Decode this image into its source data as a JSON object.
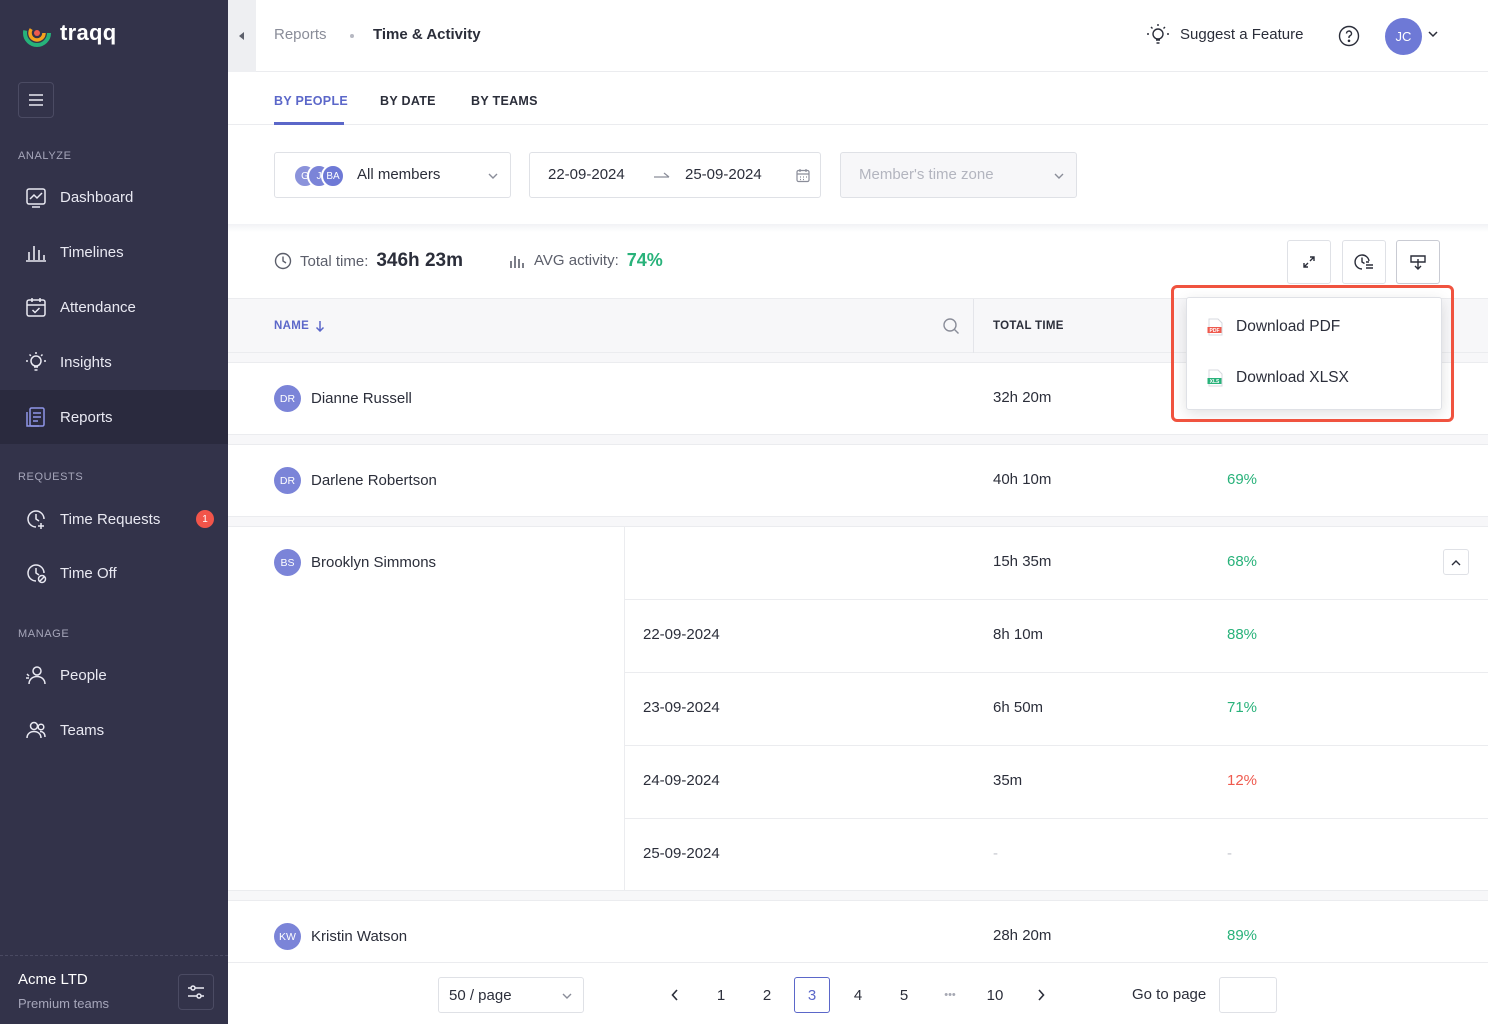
{
  "brand": {
    "name": "traqq"
  },
  "sidebar": {
    "sections": {
      "analyze": "ANALYZE",
      "requests": "REQUESTS",
      "manage": "MANAGE"
    },
    "items": {
      "dashboard": "Dashboard",
      "timelines": "Timelines",
      "attendance": "Attendance",
      "insights": "Insights",
      "reports": "Reports",
      "time_requests": "Time Requests",
      "time_requests_badge": "1",
      "time_off": "Time Off",
      "people": "People",
      "teams": "Teams"
    },
    "footer": {
      "org": "Acme LTD",
      "plan": "Premium teams"
    }
  },
  "header": {
    "breadcrumb_parent": "Reports",
    "breadcrumb_current": "Time & Activity",
    "suggest": "Suggest a Feature",
    "avatar": "JC"
  },
  "tabs": {
    "by_people": "BY PEOPLE",
    "by_date": "BY DATE",
    "by_teams": "BY TEAMS"
  },
  "filters": {
    "members_avatars": [
      "G",
      "J",
      "BA"
    ],
    "members_label": "All members",
    "date_from": "22-09-2024",
    "date_to": "25-09-2024",
    "timezone_placeholder": "Member's time zone"
  },
  "summary": {
    "total_label": "Total time:",
    "total_value": "346h 23m",
    "avg_label": "AVG activity:",
    "avg_value": "74%"
  },
  "table": {
    "col_name": "NAME",
    "col_total": "TOTAL TIME",
    "rows": [
      {
        "initials": "DR",
        "name": "Dianne Russell",
        "time": "32h 20m"
      },
      {
        "initials": "DR",
        "name": "Darlene Robertson",
        "time": "40h 10m",
        "activity": "69%"
      },
      {
        "initials": "BS",
        "name": "Brooklyn Simmons",
        "time": "15h 35m",
        "activity": "68%"
      },
      {
        "initials": "KW",
        "name": "Kristin Watson",
        "time": "28h 20m",
        "activity": "89%"
      }
    ],
    "subrows": [
      {
        "date": "22-09-2024",
        "time": "8h 10m",
        "activity": "88%"
      },
      {
        "date": "23-09-2024",
        "time": "6h 50m",
        "activity": "71%"
      },
      {
        "date": "24-09-2024",
        "time": "35m",
        "activity": "12%"
      },
      {
        "date": "25-09-2024",
        "time": "-",
        "activity": "-"
      }
    ]
  },
  "download_menu": {
    "pdf": "Download PDF",
    "xlsx": "Download XLSX",
    "pdf_tag": "PDF",
    "xlsx_tag": "XLS"
  },
  "pagination": {
    "per_page": "50 / page",
    "pages": [
      "1",
      "2",
      "3",
      "4",
      "5",
      "10"
    ],
    "ellipsis": "•••",
    "current": "3",
    "goto_label": "Go to page"
  },
  "colors": {
    "sidebar": "#33334a",
    "accent": "#5b67c9",
    "green": "#28b27a",
    "red": "#ef5a4e",
    "highlight": "#f0533f"
  }
}
